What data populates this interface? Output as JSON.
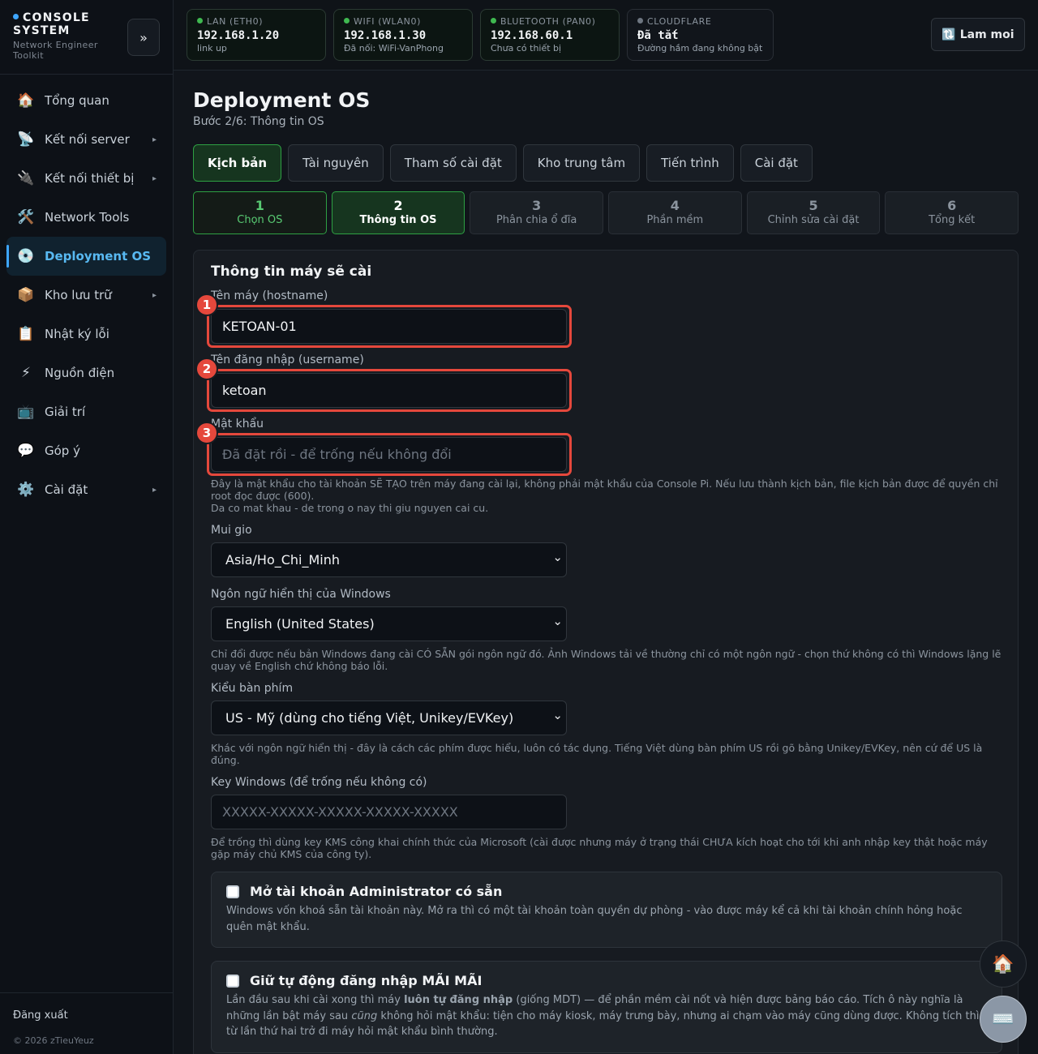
{
  "brand": {
    "title": "CONSOLE SYSTEM",
    "subtitle": "Network Engineer Toolkit",
    "collapse_label": "»"
  },
  "sidebar": {
    "items": [
      {
        "icon": "🏠",
        "label": "Tổng quan",
        "caret": ""
      },
      {
        "icon": "📡",
        "label": "Kết nối server",
        "caret": "▸"
      },
      {
        "icon": "🔌",
        "label": "Kết nối thiết bị",
        "caret": "▸"
      },
      {
        "icon": "🛠️",
        "label": "Network Tools",
        "caret": ""
      },
      {
        "icon": "💿",
        "label": "Deployment OS",
        "caret": ""
      },
      {
        "icon": "📦",
        "label": "Kho lưu trữ",
        "caret": "▸"
      },
      {
        "icon": "📋",
        "label": "Nhật ký lỗi",
        "caret": ""
      },
      {
        "icon": "⚡",
        "label": "Nguồn điện",
        "caret": ""
      },
      {
        "icon": "📺",
        "label": "Giải trí",
        "caret": ""
      },
      {
        "icon": "💬",
        "label": "Góp ý",
        "caret": ""
      },
      {
        "icon": "⚙️",
        "label": "Cài đặt",
        "caret": "▸"
      }
    ],
    "active_index": 4,
    "logout": "Đăng xuất",
    "copyright": "© 2026 zTieuYeuz"
  },
  "status_cards": [
    {
      "label": "LAN (ETH0)",
      "value": "192.168.1.20",
      "sub": "link up",
      "status": "up"
    },
    {
      "label": "WIFI (WLAN0)",
      "value": "192.168.1.30",
      "sub": "Đã nối: WiFi-VanPhong",
      "status": "up"
    },
    {
      "label": "BLUETOOTH (PAN0)",
      "value": "192.168.60.1",
      "sub": "Chưa có thiết bị",
      "status": "up"
    },
    {
      "label": "CLOUDFLARE",
      "value": "Đã tắt",
      "sub": "Đường hầm đang không bật",
      "status": "off"
    }
  ],
  "refresh_label": "🔃 Lam moi",
  "page": {
    "title": "Deployment OS",
    "subtitle": "Bước 2/6: Thông tin OS"
  },
  "tabs": [
    {
      "label": "Kịch bản"
    },
    {
      "label": "Tài nguyên"
    },
    {
      "label": "Tham số cài đặt"
    },
    {
      "label": "Kho trung tâm"
    },
    {
      "label": "Tiến trình"
    },
    {
      "label": "Cài đặt"
    }
  ],
  "steps": [
    {
      "num": "1",
      "label": "Chọn OS"
    },
    {
      "num": "2",
      "label": "Thông tin OS"
    },
    {
      "num": "3",
      "label": "Phân chia ổ đĩa"
    },
    {
      "num": "4",
      "label": "Phần mềm"
    },
    {
      "num": "5",
      "label": "Chỉnh sửa cài đặt"
    },
    {
      "num": "6",
      "label": "Tổng kết"
    }
  ],
  "form": {
    "panel_title": "Thông tin máy sẽ cài",
    "hostname": {
      "label": "Tên máy (hostname)",
      "value": "KETOAN-01",
      "marker": "1"
    },
    "username": {
      "label": "Tên đăng nhập (username)",
      "value": "ketoan",
      "marker": "2"
    },
    "password": {
      "label": "Mật khẩu",
      "placeholder": "Đã đặt rồi - để trống nếu không đổi",
      "marker": "3",
      "help1": "Đây là mật khẩu cho tài khoản SẼ TẠO trên máy đang cài lại, không phải mật khẩu của Console Pi. Nếu lưu thành kịch bản, file kịch bản được để quyền chỉ root đọc được (600).",
      "help2": "Da co mat khau - de trong o nay thi giu nguyen cai cu."
    },
    "timezone": {
      "label": "Mui gio",
      "value": "Asia/Ho_Chi_Minh"
    },
    "language": {
      "label": "Ngôn ngữ hiển thị của Windows",
      "value": "English (United States)",
      "help": "Chỉ đổi được nếu bản Windows đang cài CÓ SẴN gói ngôn ngữ đó. Ảnh Windows tải về thường chỉ có một ngôn ngữ - chọn thứ không có thì Windows lặng lẽ quay về English chứ không báo lỗi."
    },
    "keyboard": {
      "label": "Kiểu bàn phím",
      "value": "US - Mỹ (dùng cho tiếng Việt, Unikey/EVKey)",
      "help": "Khác với ngôn ngữ hiển thị - đây là cách các phím được hiểu, luôn có tác dụng. Tiếng Việt dùng bàn phím US rồi gõ bằng Unikey/EVKey, nên cứ để US là đúng."
    },
    "product_key": {
      "label": "Key Windows (để trống nếu không có)",
      "placeholder": "XXXXX-XXXXX-XXXXX-XXXXX-XXXXX",
      "help": "Để trống thì dùng key KMS công khai chính thức của Microsoft (cài được nhưng máy ở trạng thái CHƯA kích hoạt cho tới khi anh nhập key thật hoặc máy gặp máy chủ KMS của công ty)."
    },
    "admin_option": {
      "title": "Mở tài khoản Administrator có sẵn",
      "desc": "Windows vốn khoá sẵn tài khoản này. Mở ra thì có một tài khoản toàn quyền dự phòng - vào được máy kể cả khi tài khoản chính hỏng hoặc quên mật khẩu.",
      "checked": false
    },
    "autologin_option": {
      "title": "Giữ tự động đăng nhập MÃI MÃI",
      "desc_a": "Lần đầu sau khi cài xong thì máy ",
      "desc_b": "luôn tự đăng nhập",
      "desc_c": " (giống MDT) — để phần mềm cài nốt và hiện được bảng báo cáo. Tích ô này nghĩa là những lần bật máy sau ",
      "desc_d": "cũng",
      "desc_e": " không hỏi mật khẩu: tiện cho máy kiosk, máy trưng bày, nhưng ai chạm vào máy cũng dùng được. Không tích thì từ lần thứ hai trở đi máy hỏi mật khẩu bình thường.",
      "checked": false
    }
  },
  "fab": {
    "home_icon": "🏠",
    "keyboard_icon": "⌨️"
  }
}
